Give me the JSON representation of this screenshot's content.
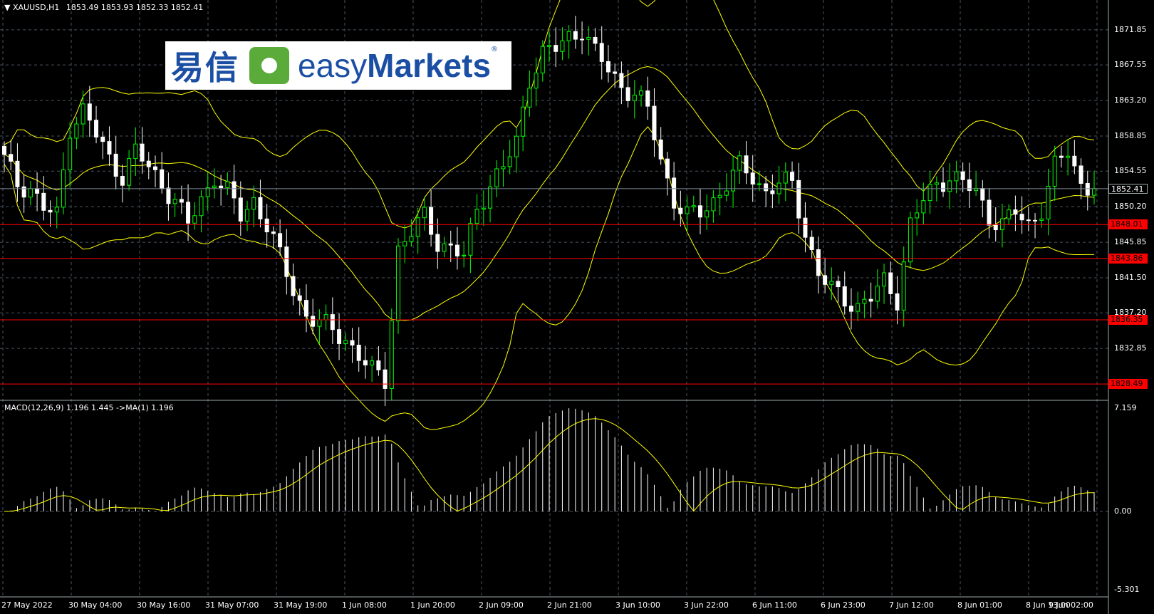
{
  "header": {
    "symbol": "XAUUSD,H1",
    "ohlc": "1853.49 1853.93 1852.33 1852.41",
    "macd_label": "MACD(12,26,9) 1.196 1.445  ->MA(1) 1.196"
  },
  "logo": {
    "cn": "易信",
    "en_light": "easy",
    "en_bold": "Markets",
    "reg": "®"
  },
  "price_axis": [
    "1871.85",
    "1867.55",
    "1863.20",
    "1858.85",
    "1854.55",
    "1850.20",
    "1845.85",
    "1841.50",
    "1837.20",
    "1832.85"
  ],
  "macd_axis": [
    "7.159",
    "0.00",
    "-5.301"
  ],
  "current_price": "1852.41",
  "levels": [
    "1848.01",
    "1843.86",
    "1836.35",
    "1828.49"
  ],
  "time_axis": [
    "27 May 2022",
    "30 May 04:00",
    "30 May 16:00",
    "31 May 07:00",
    "31 May 19:00",
    "1 Jun 08:00",
    "1 Jun 20:00",
    "2 Jun 09:00",
    "2 Jun 21:00",
    "3 Jun 10:00",
    "3 Jun 22:00",
    "6 Jun 11:00",
    "6 Jun 23:00",
    "7 Jun 12:00",
    "8 Jun 01:00",
    "8 Jun 13:00",
    "9 Jun 02:00"
  ],
  "colors": {
    "bull": "#00ff00",
    "bear": "#ffffff",
    "bands": "#ffff00",
    "level": "#ff0000",
    "grid": "#4a5560",
    "macd_hist": "#ffffff",
    "signal": "#ffff00"
  },
  "chart_data": {
    "type": "candlestick",
    "title": "XAUUSD,H1",
    "ylim": [
      1826.5,
      1875.5
    ],
    "series_close_path": [
      [
        0,
        1856
      ],
      [
        2,
        1853
      ],
      [
        4,
        1852.5
      ],
      [
        6,
        1850
      ],
      [
        8,
        1849
      ],
      [
        10,
        1860
      ],
      [
        12,
        1862
      ],
      [
        14,
        1859
      ],
      [
        16,
        1856
      ],
      [
        18,
        1854
      ],
      [
        20,
        1857
      ],
      [
        22,
        1855
      ],
      [
        24,
        1853
      ],
      [
        26,
        1851
      ],
      [
        28,
        1848
      ],
      [
        30,
        1851
      ],
      [
        32,
        1854
      ],
      [
        34,
        1852
      ],
      [
        36,
        1849
      ],
      [
        38,
        1851
      ],
      [
        40,
        1848
      ],
      [
        42,
        1844
      ],
      [
        44,
        1840
      ],
      [
        46,
        1837
      ],
      [
        48,
        1836
      ],
      [
        50,
        1835
      ],
      [
        52,
        1834
      ],
      [
        54,
        1832
      ],
      [
        56,
        1830
      ],
      [
        58,
        1829
      ],
      [
        60,
        1845
      ],
      [
        62,
        1847
      ],
      [
        64,
        1849
      ],
      [
        66,
        1846
      ],
      [
        68,
        1845
      ],
      [
        70,
        1844
      ],
      [
        72,
        1850
      ],
      [
        74,
        1853
      ],
      [
        76,
        1855
      ],
      [
        78,
        1858
      ],
      [
        80,
        1866
      ],
      [
        82,
        1869
      ],
      [
        84,
        1869.5
      ],
      [
        86,
        1871
      ],
      [
        88,
        1872
      ],
      [
        90,
        1869
      ],
      [
        92,
        1867
      ],
      [
        94,
        1865
      ],
      [
        96,
        1864
      ],
      [
        98,
        1862
      ],
      [
        100,
        1856
      ],
      [
        102,
        1851
      ],
      [
        104,
        1849
      ],
      [
        106,
        1849.5
      ],
      [
        108,
        1851
      ],
      [
        110,
        1853
      ],
      [
        112,
        1855
      ],
      [
        114,
        1854
      ],
      [
        116,
        1852
      ],
      [
        118,
        1853
      ],
      [
        120,
        1853
      ],
      [
        122,
        1847
      ],
      [
        124,
        1842
      ],
      [
        126,
        1840
      ],
      [
        128,
        1839
      ],
      [
        130,
        1838
      ],
      [
        132,
        1839
      ],
      [
        134,
        1841
      ],
      [
        136,
        1839
      ],
      [
        138,
        1848
      ],
      [
        140,
        1851
      ],
      [
        142,
        1853
      ],
      [
        144,
        1854
      ],
      [
        146,
        1853
      ],
      [
        148,
        1852
      ],
      [
        150,
        1849
      ],
      [
        152,
        1848
      ],
      [
        154,
        1849.5
      ],
      [
        156,
        1848
      ],
      [
        158,
        1850
      ],
      [
        160,
        1855
      ],
      [
        162,
        1857
      ],
      [
        164,
        1853
      ],
      [
        166,
        1852.41
      ]
    ]
  }
}
